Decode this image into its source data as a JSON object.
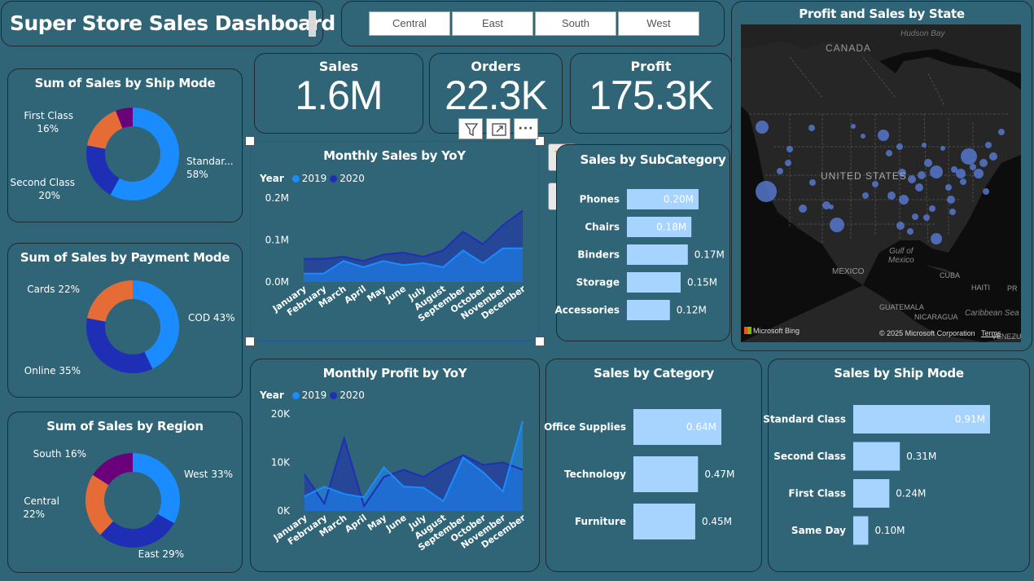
{
  "header": {
    "title": "Super Store Sales Dashboard"
  },
  "region_slicer": {
    "options": [
      "Central",
      "East",
      "South",
      "West"
    ]
  },
  "kpis": [
    {
      "label": "Sales",
      "value": "1.6M"
    },
    {
      "label": "Orders",
      "value": "22.3K"
    },
    {
      "label": "Profit",
      "value": "175.3K"
    }
  ],
  "visual_toolbar": {
    "icons": [
      "filter-icon",
      "focus-mode-icon",
      "more-options-icon"
    ]
  },
  "side_buttons": {
    "icons": [
      "build-visual-icon",
      "format-visual-icon"
    ]
  },
  "colors": {
    "background": "#2f6577",
    "series_2019": "#1a8cff",
    "series_2020": "#1f2fb5",
    "bar_light": "#a7d3ff",
    "orange": "#e66c37",
    "purple": "#6b007b",
    "dark_navy": "#1d2a30"
  },
  "map": {
    "title": "Profit and Sales by State",
    "labels": {
      "hudson_bay": "Hudson Bay",
      "canada": "CANADA",
      "united_states": "UNITED STATES",
      "gulf": "Gulf of\nMexico",
      "mexico": "MEXICO",
      "cuba": "CUBA",
      "haiti": "HAITI",
      "pr": "PR",
      "guatemala": "GUATEMALA",
      "nicaragua": "NICARAGUA",
      "caribbean": "Caribbean Sea",
      "venezuela": "VENEZU"
    },
    "bing": "Microsoft Bing",
    "copyright": "© 2025 Microsoft Corporation",
    "terms": "Terms"
  },
  "chart_data": [
    {
      "id": "ship_mode_donut",
      "type": "pie",
      "title": "Sum of Sales by Ship Mode",
      "categories": [
        "Standar...",
        "Second Class",
        "First Class",
        "Same Day"
      ],
      "values": [
        58,
        20,
        16,
        6
      ],
      "value_labels": [
        "58%",
        "20%",
        "16%",
        ""
      ],
      "colors": [
        "#1a8cff",
        "#1f2fb5",
        "#e66c37",
        "#6b007b"
      ]
    },
    {
      "id": "payment_mode_donut",
      "type": "pie",
      "title": "Sum of Sales by Payment Mode",
      "categories": [
        "COD",
        "Online",
        "Cards"
      ],
      "values": [
        43,
        35,
        22
      ],
      "value_labels": [
        "43%",
        "35%",
        "22%"
      ],
      "colors": [
        "#1a8cff",
        "#1f2fb5",
        "#e66c37"
      ]
    },
    {
      "id": "region_donut",
      "type": "pie",
      "title": "Sum of Sales by Region",
      "categories": [
        "West",
        "East",
        "Central",
        "South"
      ],
      "values": [
        33,
        29,
        22,
        16
      ],
      "value_labels": [
        "33%",
        "29%",
        "22%",
        "16%"
      ],
      "colors": [
        "#1a8cff",
        "#1f2fb5",
        "#e66c37",
        "#6b007b"
      ]
    },
    {
      "id": "monthly_sales",
      "type": "area",
      "title": "Monthly Sales by YoY",
      "legend_title": "Year",
      "categories": [
        "January",
        "February",
        "March",
        "April",
        "May",
        "June",
        "July",
        "August",
        "September",
        "October",
        "November",
        "December"
      ],
      "series": [
        {
          "name": "2019",
          "values": [
            0.02,
            0.02,
            0.05,
            0.035,
            0.05,
            0.04,
            0.045,
            0.035,
            0.075,
            0.045,
            0.08,
            0.08
          ]
        },
        {
          "name": "2020",
          "values": [
            0.055,
            0.055,
            0.06,
            0.05,
            0.065,
            0.07,
            0.06,
            0.075,
            0.12,
            0.09,
            0.135,
            0.17
          ]
        }
      ],
      "ylim": [
        0,
        0.2
      ],
      "yticks": [
        "0.0M",
        "0.1M",
        "0.2M"
      ],
      "ytick_values": [
        0,
        0.1,
        0.2
      ]
    },
    {
      "id": "monthly_profit",
      "type": "area",
      "title": "Monthly Profit by YoY",
      "legend_title": "Year",
      "categories": [
        "January",
        "February",
        "March",
        "April",
        "May",
        "June",
        "July",
        "August",
        "September",
        "October",
        "November",
        "December"
      ],
      "series": [
        {
          "name": "2019",
          "values": [
            3000,
            5000,
            3500,
            2800,
            9000,
            5000,
            4800,
            2000,
            11000,
            8000,
            4000,
            18500
          ]
        },
        {
          "name": "2020",
          "values": [
            7500,
            1500,
            15000,
            1000,
            7000,
            8500,
            7000,
            9500,
            11500,
            9500,
            10000,
            8500
          ]
        }
      ],
      "ylim": [
        0,
        20000
      ],
      "yticks": [
        "0K",
        "10K",
        "20K"
      ],
      "ytick_values": [
        0,
        10000,
        20000
      ]
    },
    {
      "id": "subcategory_bars",
      "type": "bar",
      "title": "Sales by SubCategory",
      "categories": [
        "Phones",
        "Chairs",
        "Binders",
        "Storage",
        "Accessories"
      ],
      "values": [
        0.2,
        0.18,
        0.17,
        0.15,
        0.12
      ],
      "value_labels": [
        "0.20M",
        "0.18M",
        "0.17M",
        "0.15M",
        "0.12M"
      ]
    },
    {
      "id": "category_bars",
      "type": "bar",
      "title": "Sales by Category",
      "categories": [
        "Office Supplies",
        "Technology",
        "Furniture"
      ],
      "values": [
        0.64,
        0.47,
        0.45
      ],
      "value_labels": [
        "0.64M",
        "0.47M",
        "0.45M"
      ]
    },
    {
      "id": "ship_mode_bars",
      "type": "bar",
      "title": "Sales by Ship Mode",
      "categories": [
        "Standard Class",
        "Second Class",
        "First Class",
        "Same Day"
      ],
      "values": [
        0.91,
        0.31,
        0.24,
        0.1
      ],
      "value_labels": [
        "0.91M",
        "0.31M",
        "0.24M",
        "0.10M"
      ]
    }
  ]
}
